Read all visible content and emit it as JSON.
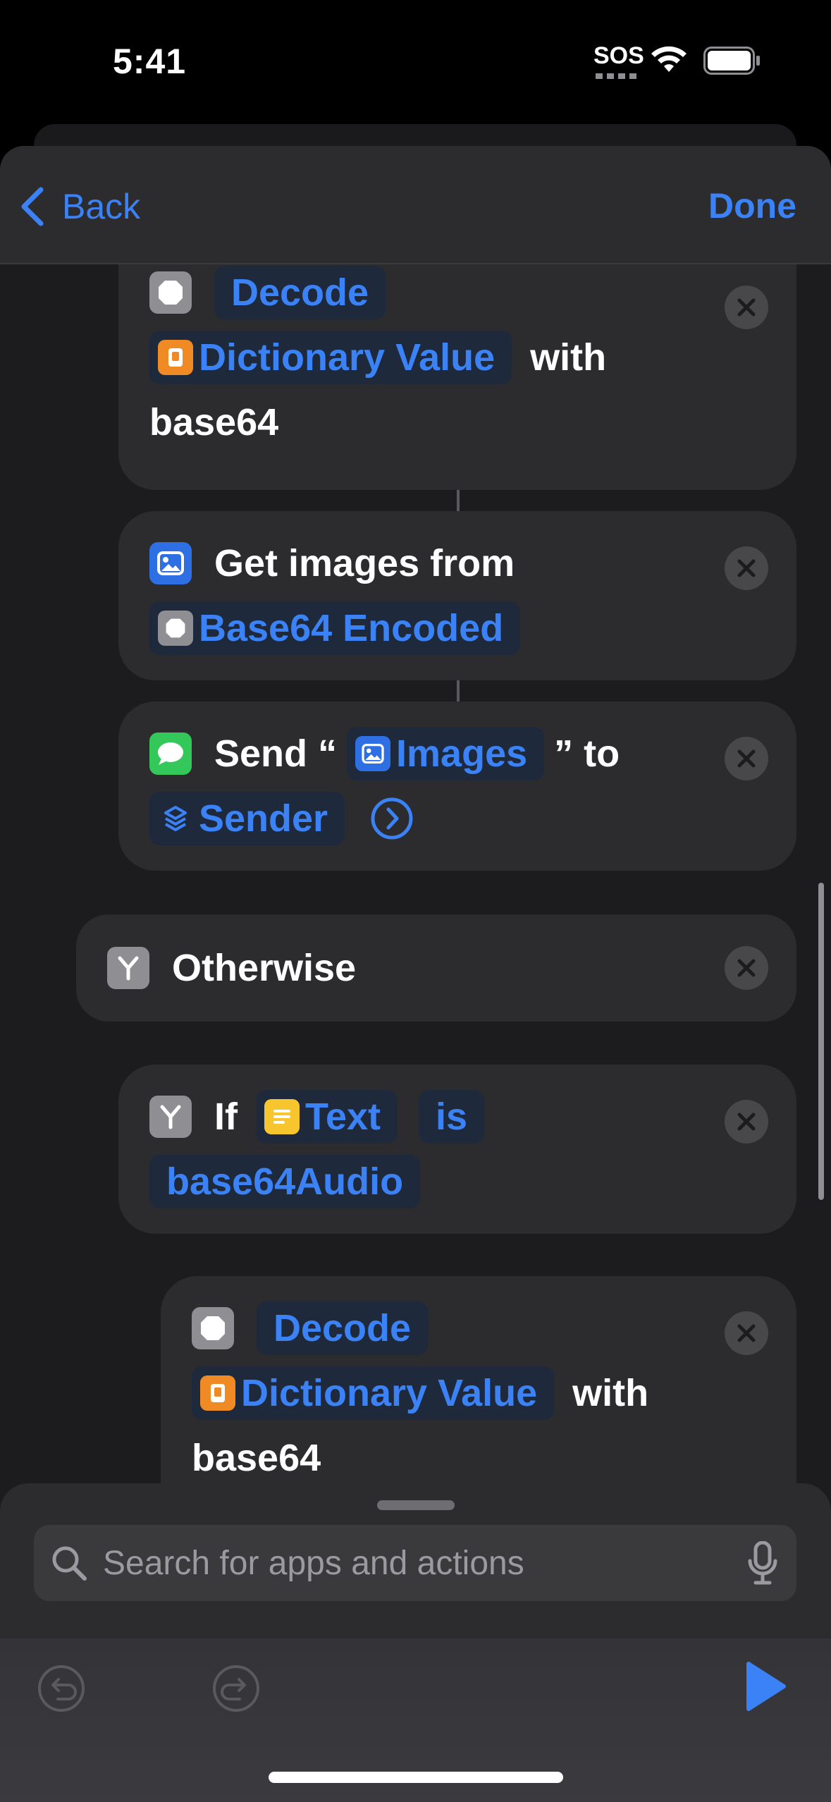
{
  "status_bar": {
    "time": "5:41",
    "sos": "SOS"
  },
  "nav": {
    "back_label": "Back",
    "done_label": "Done"
  },
  "actions": {
    "decode_1": {
      "verb": "Decode",
      "input": "Dictionary Value",
      "with": "with",
      "format": "base64"
    },
    "get_images": {
      "text": "Get images from",
      "source": "Base64 Encoded"
    },
    "send": {
      "verb": "Send “",
      "content": "Images",
      "to": "” to",
      "recipient": "Sender"
    },
    "otherwise": {
      "label": "Otherwise"
    },
    "if_block": {
      "if": "If",
      "variable": "Text",
      "condition": "is",
      "value": "base64Audio"
    },
    "decode_2": {
      "verb": "Decode",
      "input": "Dictionary Value",
      "with": "with",
      "format": "base64"
    }
  },
  "search": {
    "placeholder": "Search for apps and actions"
  },
  "colors": {
    "accent": "#3b82f6",
    "card": "#2c2c2e",
    "sheet": "#1c1c1e"
  }
}
